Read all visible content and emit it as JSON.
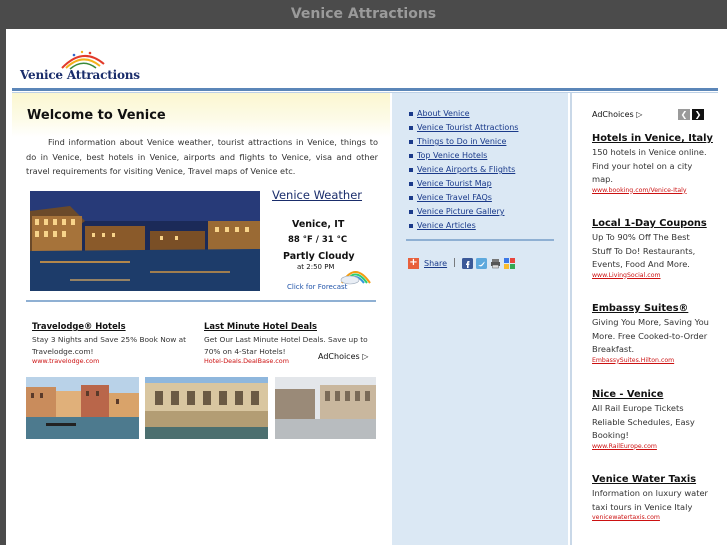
{
  "window": {
    "title": "Venice Attractions"
  },
  "logo": {
    "text": "Venice Attractions"
  },
  "main": {
    "heading": "Welcome to Venice",
    "intro": "Find information about Venice weather, tourist attractions in Venice, things to do in Venice, best hotels in Venice, airports and flights to Venice, visa and other travel requirements for visiting Venice, Travel maps of Venice etc."
  },
  "weather": {
    "title": "Venice Weather",
    "city": "Venice, IT",
    "temp": "88 °F / 31 °C",
    "condition": "Partly Cloudy",
    "time": "at 2:50 PM",
    "forecast_link": "Click for Forecast"
  },
  "main_ads": [
    {
      "headline": "Travelodge® Hotels",
      "desc": "Stay 3 Nights and Save 25% Book Now at Travelodge.com!",
      "url": "www.travelodge.com"
    },
    {
      "headline": "Last Minute Hotel Deals",
      "desc": "Get Our Last Minute Hotel Deals. Save up to 70% on 4-Star Hotels!",
      "url": "Hotel-Deals.DealBase.com"
    }
  ],
  "adchoices_label": "AdChoices",
  "nav": {
    "items": [
      "About Venice",
      "Venice Tourist Attractions",
      "Things to Do in Venice",
      "Top Venice Hotels",
      "Venice Airports & Flights",
      "Venice Tourist Map",
      "Venice Travel FAQs",
      "Venice Picture Gallery",
      "Venice Articles"
    ],
    "share_label": "Share",
    "share_separator": "|"
  },
  "right_ads": [
    {
      "headline": "Hotels in Venice, Italy",
      "desc": "150 hotels in Venice online. Find your hotel on a city map.",
      "url": "www.booking.com/Venice-Italy"
    },
    {
      "headline": "Local 1-Day Coupons",
      "desc": "Up To 90% Off The Best Stuff To Do! Restaurants, Events, Food And More.",
      "url": "www.LivingSocial.com"
    },
    {
      "headline": "Embassy Suites®",
      "desc": "Giving You More, Saving You More. Free Cooked-to-Order Breakfast.",
      "url": "EmbassySuites.Hilton.com"
    },
    {
      "headline": "Nice - Venice",
      "desc": "All Rail Europe Tickets Reliable Schedules, Easy Booking!",
      "url": "www.RailEurope.com"
    },
    {
      "headline": "Venice Water Taxis",
      "desc": "Information on luxury water taxi tours in Venice Italy",
      "url": "venicewatertaxis.com"
    }
  ],
  "colors": {
    "accent": "#5b86b8",
    "nav_link": "#1a3a8a",
    "ad_url": "#cc1111",
    "titlebar": "#4b4b4b"
  }
}
